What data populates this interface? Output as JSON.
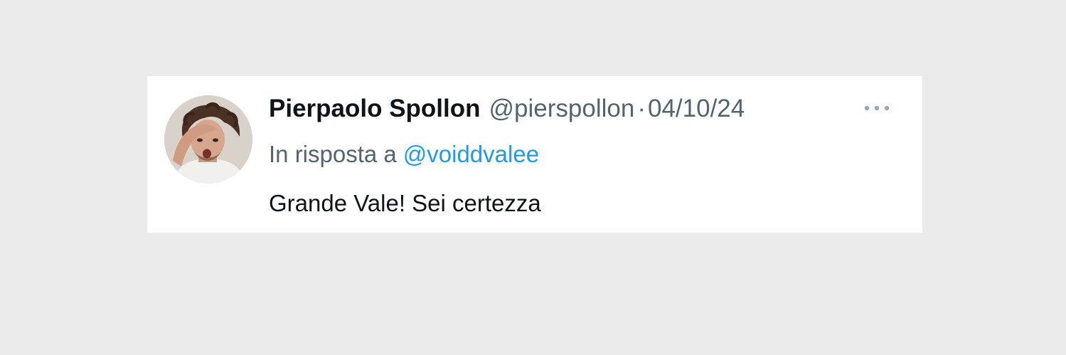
{
  "tweet": {
    "author_name": "Pierpaolo Spollon",
    "author_handle": "@pierspollon",
    "separator": "·",
    "timestamp": "04/10/24",
    "more_icon": "more-horizontal-icon",
    "reply_prefix": "In risposta a",
    "reply_mention": "@voiddvalee",
    "text": "Grande Vale! Sei certezza"
  },
  "colors": {
    "page_background": "#ebebeb",
    "card_background": "#ffffff",
    "primary_text": "#0f1419",
    "secondary_text": "#536471",
    "mention": "#1d9bf0"
  }
}
